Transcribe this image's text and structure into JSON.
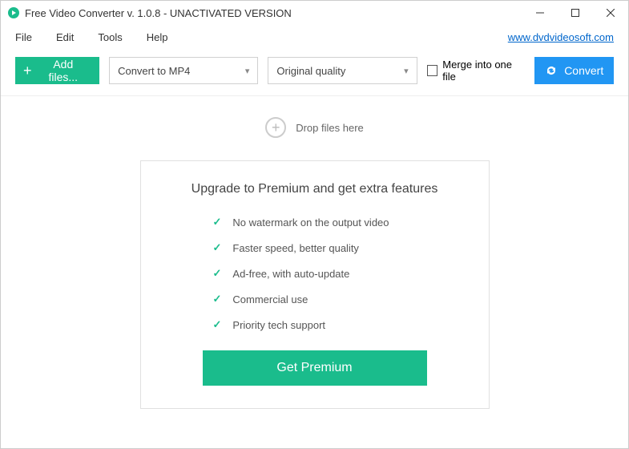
{
  "titlebar": {
    "title": "Free Video Converter v. 1.0.8 - UNACTIVATED VERSION"
  },
  "menubar": {
    "items": [
      "File",
      "Edit",
      "Tools",
      "Help"
    ],
    "link": "www.dvdvideosoft.com"
  },
  "toolbar": {
    "add_label": "Add files...",
    "format_selected": "Convert to MP4",
    "quality_selected": "Original quality",
    "merge_label": "Merge into one file",
    "convert_label": "Convert"
  },
  "dropzone": {
    "label": "Drop files here"
  },
  "premium": {
    "title": "Upgrade to Premium and get extra features",
    "features": [
      "No watermark on the output video",
      "Faster speed, better quality",
      "Ad-free, with auto-update",
      "Commercial use",
      "Priority tech support"
    ],
    "button": "Get Premium"
  }
}
